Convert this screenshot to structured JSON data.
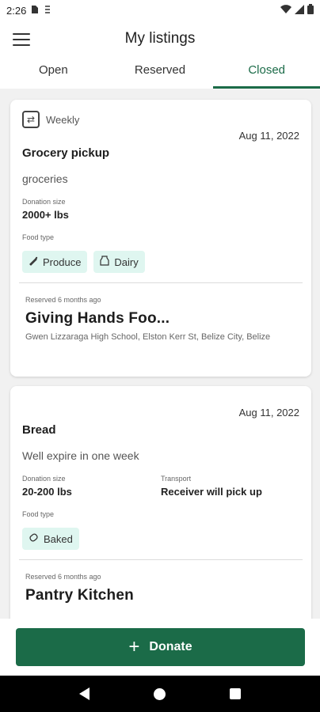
{
  "status_bar": {
    "time": "2:26"
  },
  "app_bar": {
    "title": "My listings"
  },
  "tabs": [
    {
      "label": "Open"
    },
    {
      "label": "Reserved"
    },
    {
      "label": "Closed"
    }
  ],
  "active_tab": "Closed",
  "listings": [
    {
      "frequency": "Weekly",
      "date": "Aug 11, 2022",
      "title": "Grocery pickup",
      "description": "groceries",
      "donation_size_label": "Donation size",
      "donation_size": "2000+ lbs",
      "food_type_label": "Food type",
      "food_types": [
        "Produce",
        "Dairy"
      ],
      "reserved_text": "Reserved 6 months ago",
      "organization": "Giving Hands Foo...",
      "address": "Gwen Lizzaraga High School, Elston Kerr St, Belize City, Belize"
    },
    {
      "date": "Aug 11, 2022",
      "title": "Bread",
      "description": "Well expire in one week",
      "donation_size_label": "Donation size",
      "donation_size": "20-200 lbs",
      "transport_label": "Transport",
      "transport": "Receiver will pick up",
      "food_type_label": "Food type",
      "food_types": [
        "Baked"
      ],
      "reserved_text": "Reserved 6 months ago",
      "organization": "Pantry Kitchen"
    }
  ],
  "donate_button": {
    "label": "Donate"
  },
  "colors": {
    "accent": "#1b6b48",
    "chip_bg": "#dff6f0",
    "list_bg": "#f1f1f1"
  }
}
